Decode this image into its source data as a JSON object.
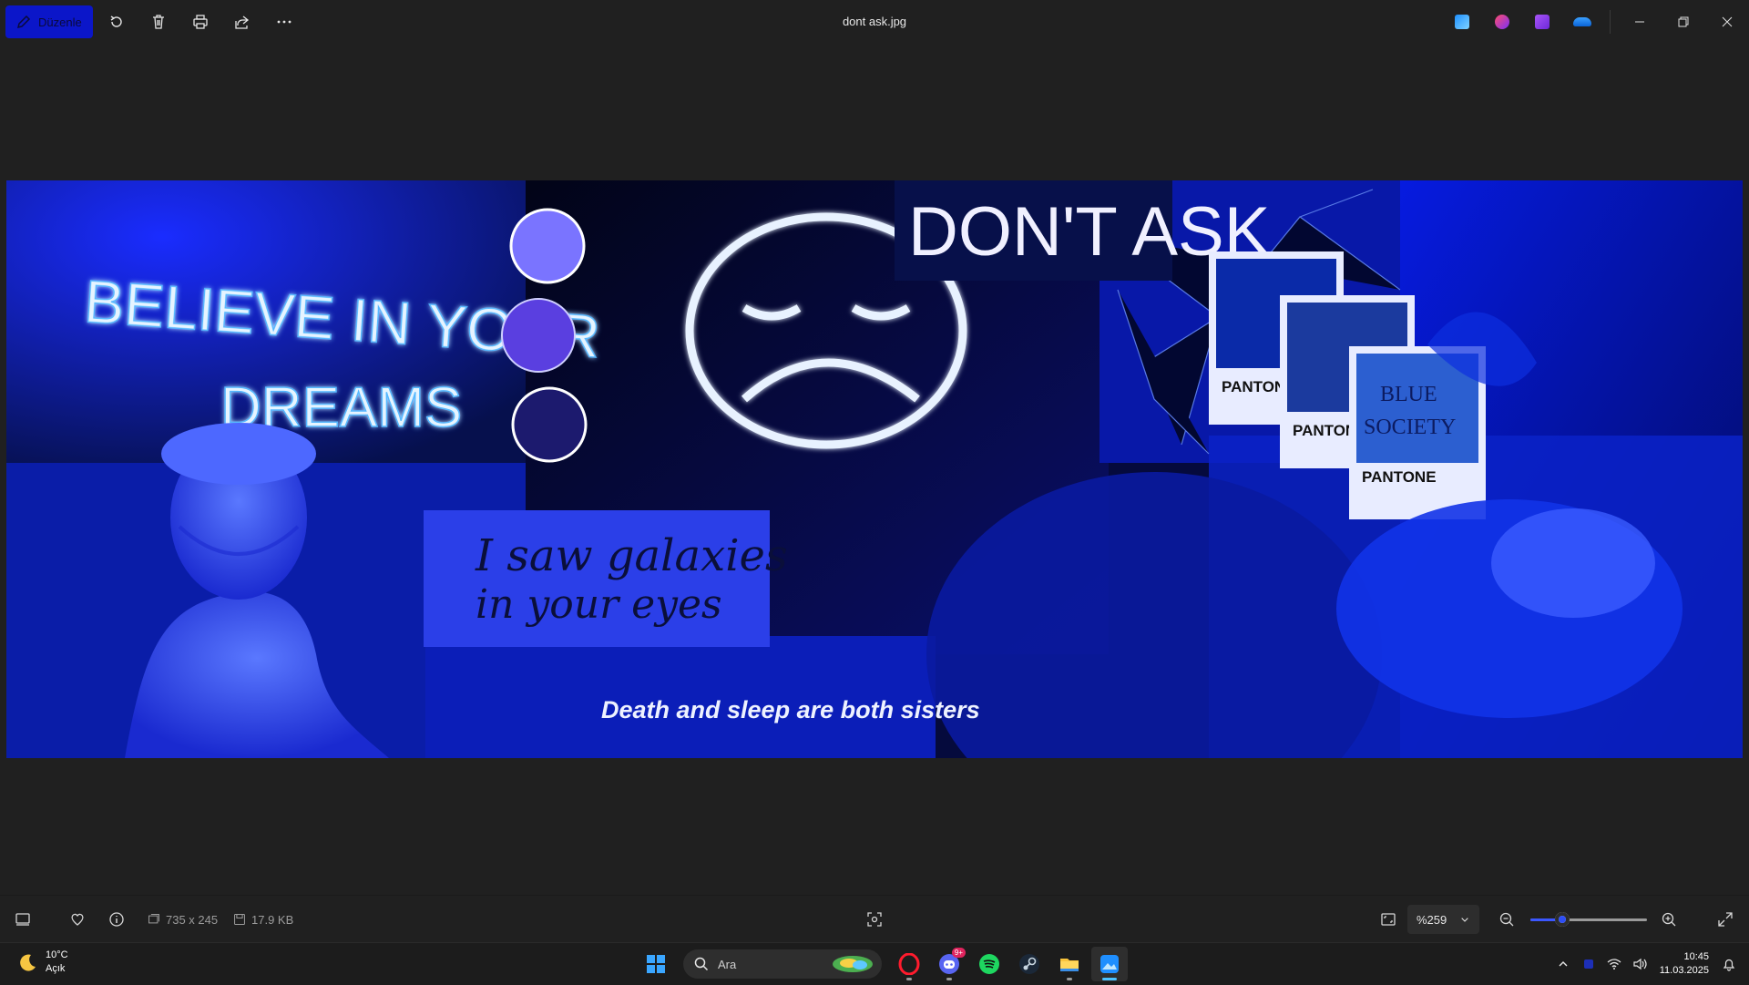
{
  "titlebar": {
    "edit_label": "Düzenle",
    "file_name": "dont ask.jpg",
    "toolbar_icons": [
      "rotate-icon",
      "delete-icon",
      "print-icon",
      "share-icon",
      "more-icon"
    ],
    "app_icons": [
      "photos-app-icon",
      "paint-app-icon",
      "clipchamp-icon",
      "onedrive-icon"
    ]
  },
  "image": {
    "texts": {
      "believe": "BELIEVE IN YOUR",
      "dreams": "DREAMS",
      "dont_ask": "DON'T ASK",
      "galaxies_1": "I saw galaxies",
      "galaxies_2": "in your eyes",
      "death": "Death and sleep are both sisters",
      "pantone_1": "PANTON",
      "pantone_2": "PANTON",
      "pantone_3": "PANTONE",
      "blue_1": "BLUE",
      "blue_2": "SOCIETY"
    },
    "swatches": [
      "#7a74ff",
      "#5a3fe0",
      "#1c1a6e"
    ]
  },
  "statusbar": {
    "dimensions": "735 x 245",
    "file_size": "17.9 KB",
    "zoom_value": "%259",
    "zoom_level": 0.27
  },
  "taskbar": {
    "weather_temp": "10°C",
    "weather_desc": "Açık",
    "search_placeholder": "Ara",
    "discord_badge": "9+",
    "time": "10:45",
    "date": "11.03.2025",
    "pinned": [
      "start-icon",
      "opera-icon",
      "discord-icon",
      "spotify-icon",
      "steam-icon",
      "file-explorer-icon",
      "photos-icon"
    ]
  }
}
